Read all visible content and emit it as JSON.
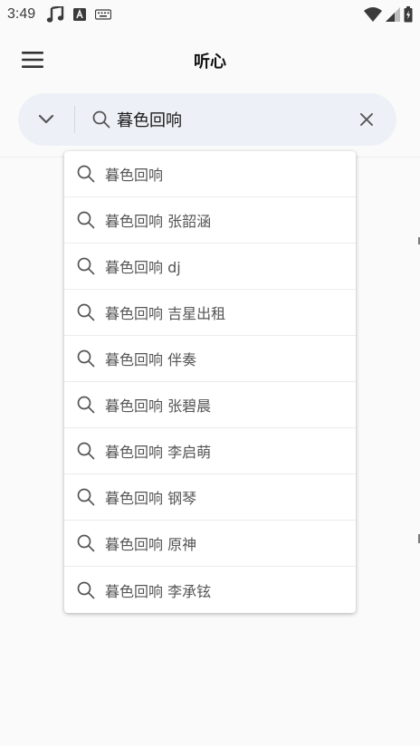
{
  "status_bar": {
    "time": "3:49",
    "left_icons": [
      "music-note-icon",
      "a-letter-icon",
      "keyboard-icon"
    ],
    "right_icons": [
      "wifi-icon",
      "cellular-signal-icon",
      "battery-icon"
    ]
  },
  "app_bar": {
    "menu_icon": "hamburger-menu-icon",
    "title": "听心"
  },
  "search": {
    "value": "暮色回响",
    "placeholder": "",
    "dropdown_icon": "chevron-down-icon",
    "search_icon": "search-icon",
    "clear_icon": "close-icon"
  },
  "suggestions": [
    {
      "label": "暮色回响"
    },
    {
      "label": "暮色回响 张韶涵"
    },
    {
      "label": "暮色回响 dj"
    },
    {
      "label": "暮色回响 吉星出租"
    },
    {
      "label": "暮色回响 伴奏"
    },
    {
      "label": "暮色回响 张碧晨"
    },
    {
      "label": "暮色回响 李启萌"
    },
    {
      "label": "暮色回响 钢琴"
    },
    {
      "label": "暮色回响 原神"
    },
    {
      "label": "暮色回响 李承铉"
    }
  ],
  "colors": {
    "background": "#fafafa",
    "search_bar_bg": "#eef0f7",
    "icon_gray": "#555555",
    "text_dark": "#1a1a1a"
  }
}
